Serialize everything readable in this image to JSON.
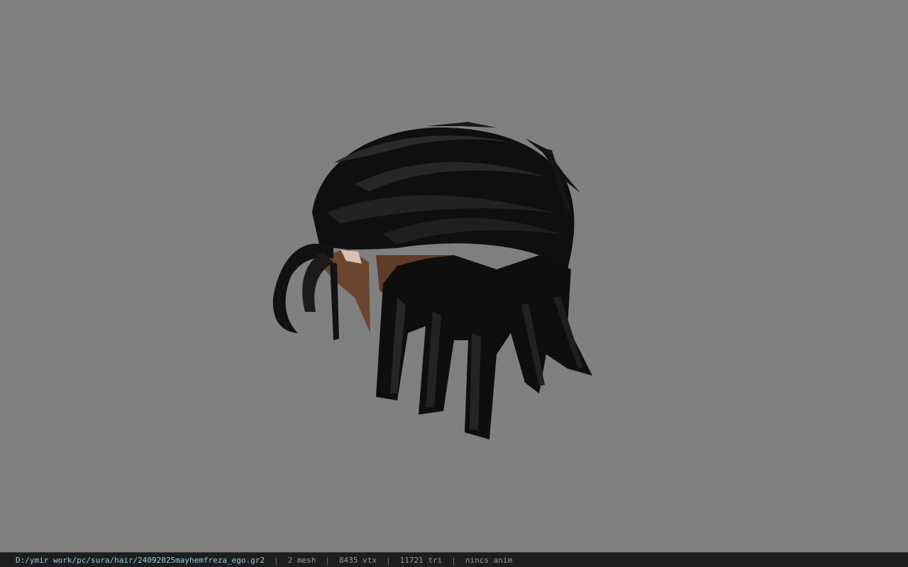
{
  "viewport": {
    "background_color": "#808080",
    "model": {
      "description_icon": "hair-mesh",
      "hair_color": "#0d0d0d",
      "skin_color": "#6b4530"
    }
  },
  "status_bar": {
    "file_path": "D:/ymir work/pc/sura/hair/24092025mayhemfreza_ego.gr2",
    "separator": "|",
    "mesh_count": "2 mesh",
    "vertex_count": "8435 vtx",
    "triangle_count": "11721 tri",
    "animation_status": "nincs anim",
    "path_color": "#8fd0e8"
  }
}
